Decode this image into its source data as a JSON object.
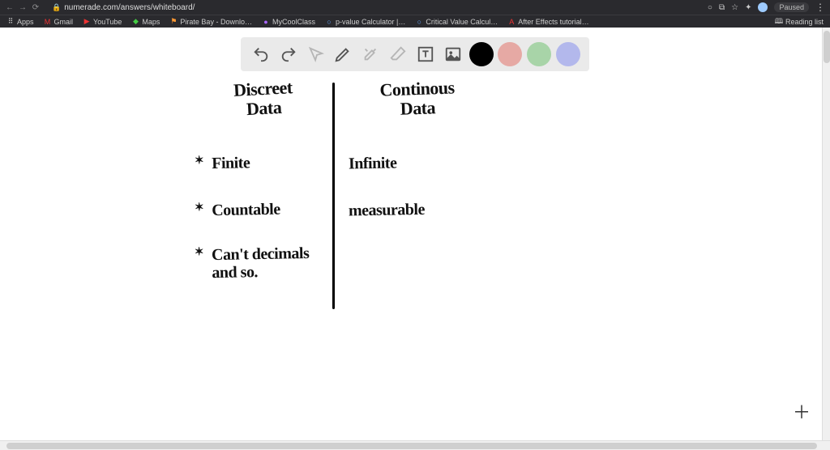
{
  "browser": {
    "url": "numerade.com/answers/whiteboard/",
    "profile_status": "Paused",
    "reading_list_label": "Reading list"
  },
  "bookmarks": {
    "apps": "Apps",
    "gmail": "Gmail",
    "youtube": "YouTube",
    "maps": "Maps",
    "piratebay": "Pirate Bay - Downlo…",
    "mycoolclass": "MyCoolClass",
    "pvalue": "p-value Calculator |…",
    "criticalvalue": "Critical Value Calcul…",
    "aftereffects": "After Effects tutorial…"
  },
  "toolbar": {
    "colors": {
      "black": "#000000",
      "red": "#e6a9a4",
      "green": "#a8d4a8",
      "blue": "#b3b8ec"
    }
  },
  "whiteboard": {
    "left_title_1": "Discreet",
    "left_title_2": "Data",
    "right_title_1": "Continous",
    "right_title_2": "Data",
    "left_items": {
      "0": "Finite",
      "1": "Countable",
      "2a": "Can't decimals",
      "2b": "and so."
    },
    "right_items": {
      "0": "Infinite",
      "1": "measurable"
    }
  }
}
